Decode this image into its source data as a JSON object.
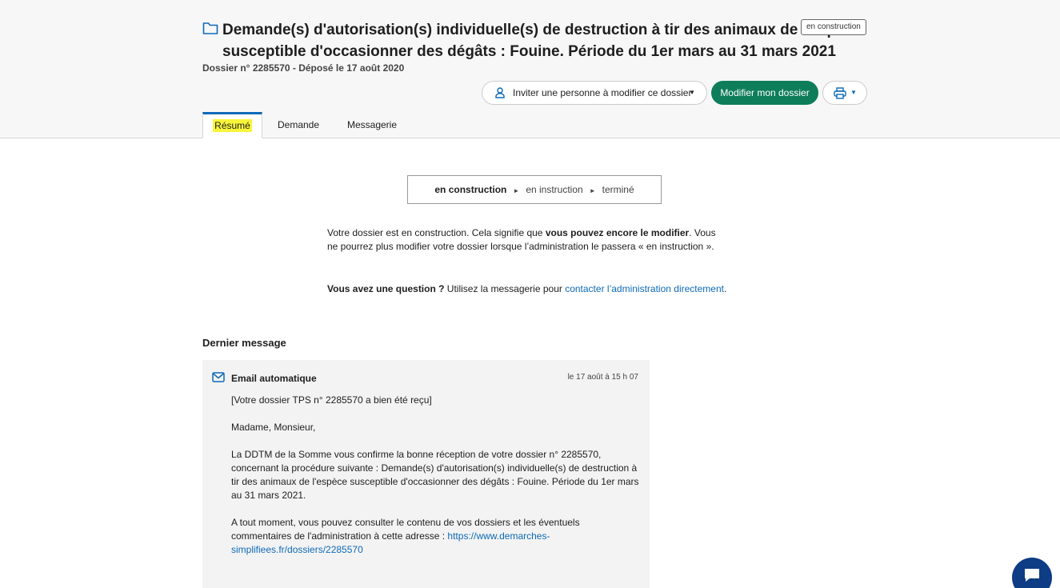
{
  "header": {
    "title": "Demande(s) d'autorisation(s) individuelle(s) de destruction à tir des animaux de l'espèce susceptible d'occasionner des dégâts : Fouine. Période du 1er mars au 31 mars 2021",
    "status_tag": "en construction",
    "subtitle": "Dossier n° 2285570 - Déposé le 17 août 2020",
    "invite_label": "Inviter une personne à modifier ce dossier",
    "modify_label": "Modifier mon dossier"
  },
  "tabs": [
    {
      "label": "Résumé",
      "active": true
    },
    {
      "label": "Demande",
      "active": false
    },
    {
      "label": "Messagerie",
      "active": false
    }
  ],
  "progress": {
    "steps": [
      "en construction",
      "en instruction",
      "terminé"
    ]
  },
  "info": {
    "p1_a": "Votre dossier est en construction. Cela signifie que ",
    "p1_b": "vous pouvez encore le modifier",
    "p1_c": ". Vous ne pourrez plus modifier votre dossier lorsque l’administration le passera « en instruction ».",
    "p2_a": "Vous avez une question ?",
    "p2_b": " Utilisez la messagerie pour ",
    "p2_link": "contacter l’administration directement",
    "p2_c": "."
  },
  "last_message": {
    "section_title": "Dernier message",
    "from": "Email automatique",
    "date": "le 17 août à 15 h 07",
    "p1": "[Votre dossier TPS n° 2285570 a bien été reçu]",
    "p2": "Madame, Monsieur,",
    "p3": "La DDTM de la Somme vous confirme la bonne réception de votre dossier n° 2285570, concernant la procédure suivante : Demande(s) d'autorisation(s) individuelle(s) de destruction à tir des animaux de l'espèce susceptible d'occasionner des dégâts : Fouine. Période du 1er mars au 31 mars 2021.",
    "p4_a": "A tout moment, vous pouvez consulter le contenu de vos dossiers et les éventuels commentaires de l'administration à cette adresse : ",
    "p4_link": "https://www.demarches-simplifiees.fr/dossiers/2285570"
  },
  "colors": {
    "accent": "#0e6ab8",
    "primary_button": "#0e7d5a",
    "highlight": "#f8f43a",
    "chat": "#0e3c85"
  }
}
